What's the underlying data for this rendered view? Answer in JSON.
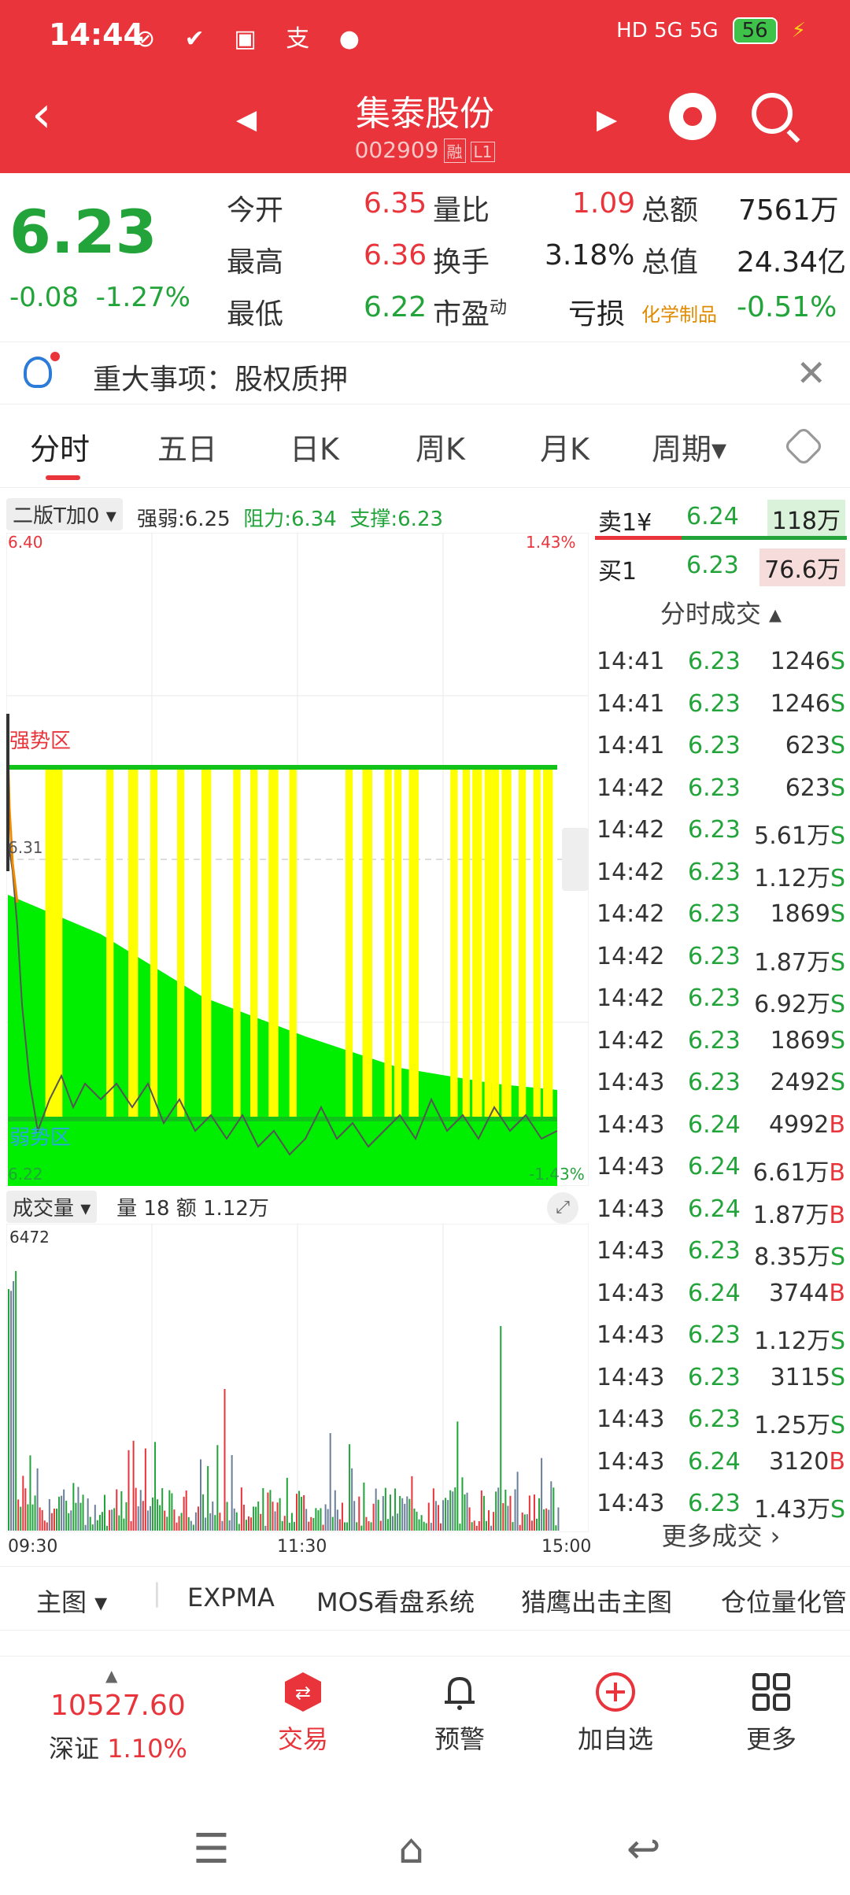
{
  "status": {
    "time": "14:44",
    "icons_left": "⊘ ✔ ▣ 支 ●",
    "signal": "HD 5G 5G",
    "battery": "56",
    "charging": "⚡"
  },
  "header": {
    "title": "集泰股份",
    "code": "002909",
    "tag_rong": "融",
    "tag_l1": "L1"
  },
  "quote": {
    "price": "6.23",
    "change": "-0.08",
    "change_pct": "-1.27%",
    "open_label": "今开",
    "open": "6.35",
    "vr_label": "量比",
    "vr": "1.09",
    "amount_label": "总额",
    "amount": "7561万",
    "high_label": "最高",
    "high": "6.36",
    "turnover_label": "换手",
    "turnover": "3.18%",
    "mcap_label": "总值",
    "mcap": "24.34亿",
    "low_label": "最低",
    "low": "6.22",
    "pe_label": "市盈",
    "pe_sup": "动",
    "pe": "亏损",
    "sector": "化学制品",
    "sector_pct": "-0.51%"
  },
  "notice": {
    "text": "重大事项：股权质押"
  },
  "tabs": {
    "t1": "分时",
    "t2": "五日",
    "t3": "日K",
    "t4": "周K",
    "t5": "月K",
    "t6": "周期▾"
  },
  "chart": {
    "indicator": "二版T加0",
    "strength": "强弱:6.25",
    "resistance": "阻力:6.34",
    "support": "支撑:6.23",
    "y_top": "6.40",
    "y_top_pct": "1.43%",
    "y_bot": "6.22",
    "y_bot_pct": "-1.43%",
    "y_mid": "6.31",
    "strong_zone": "强势区",
    "weak_zone": "弱势区",
    "vol_label": "成交量",
    "vol_info": "量 18  额 1.12万",
    "vol_max": "6472",
    "x_start": "09:30",
    "x_mid": "11:30",
    "x_end": "15:00"
  },
  "orderbook": {
    "sell_label": "卖1¥",
    "sell_price": "6.24",
    "sell_vol": "118万",
    "buy_label": "买1",
    "buy_price": "6.23",
    "buy_vol": "76.6万"
  },
  "trades": {
    "header": "分时成交 ▴",
    "rows": [
      {
        "t": "14:41",
        "p": "6.23",
        "v": "1246S",
        "c": "green"
      },
      {
        "t": "14:41",
        "p": "6.23",
        "v": "1246S",
        "c": "green"
      },
      {
        "t": "14:41",
        "p": "6.23",
        "v": "623S",
        "c": "green"
      },
      {
        "t": "14:42",
        "p": "6.23",
        "v": "623S",
        "c": "green"
      },
      {
        "t": "14:42",
        "p": "6.23",
        "v": "5.61万S",
        "c": "green"
      },
      {
        "t": "14:42",
        "p": "6.23",
        "v": "1.12万S",
        "c": "green"
      },
      {
        "t": "14:42",
        "p": "6.23",
        "v": "1869S",
        "c": "green"
      },
      {
        "t": "14:42",
        "p": "6.23",
        "v": "1.87万S",
        "c": "green"
      },
      {
        "t": "14:42",
        "p": "6.23",
        "v": "6.92万S",
        "c": "green"
      },
      {
        "t": "14:42",
        "p": "6.23",
        "v": "1869S",
        "c": "green"
      },
      {
        "t": "14:43",
        "p": "6.23",
        "v": "2492S",
        "c": "green"
      },
      {
        "t": "14:43",
        "p": "6.24",
        "v": "4992B",
        "c": "green"
      },
      {
        "t": "14:43",
        "p": "6.24",
        "v": "6.61万B",
        "c": "green"
      },
      {
        "t": "14:43",
        "p": "6.24",
        "v": "1.87万B",
        "c": "green"
      },
      {
        "t": "14:43",
        "p": "6.23",
        "v": "8.35万S",
        "c": "green"
      },
      {
        "t": "14:43",
        "p": "6.24",
        "v": "3744B",
        "c": "green"
      },
      {
        "t": "14:43",
        "p": "6.23",
        "v": "1.12万S",
        "c": "green"
      },
      {
        "t": "14:43",
        "p": "6.23",
        "v": "3115S",
        "c": "green"
      },
      {
        "t": "14:43",
        "p": "6.23",
        "v": "1.25万S",
        "c": "green"
      },
      {
        "t": "14:43",
        "p": "6.24",
        "v": "3120B",
        "c": "green"
      },
      {
        "t": "14:43",
        "p": "6.23",
        "v": "1.43万S",
        "c": "green"
      }
    ],
    "more": "更多成交 ›"
  },
  "indicators": {
    "main": "主图 ▾",
    "i1": "EXPMA",
    "i2": "MOS看盘系统",
    "i3": "猎鹰出击主图",
    "i4": "仓位量化管"
  },
  "bottom": {
    "index_value": "10527.60",
    "index_name": "深证",
    "index_pct": "1.10%",
    "trade": "交易",
    "alert": "预警",
    "add": "加自选",
    "more": "更多"
  },
  "colors": {
    "brand": "#e8343a",
    "up": "#e8343a",
    "down": "#22a43a",
    "yellow_bars": "#ffff00",
    "green_fill": "#00ee00"
  }
}
